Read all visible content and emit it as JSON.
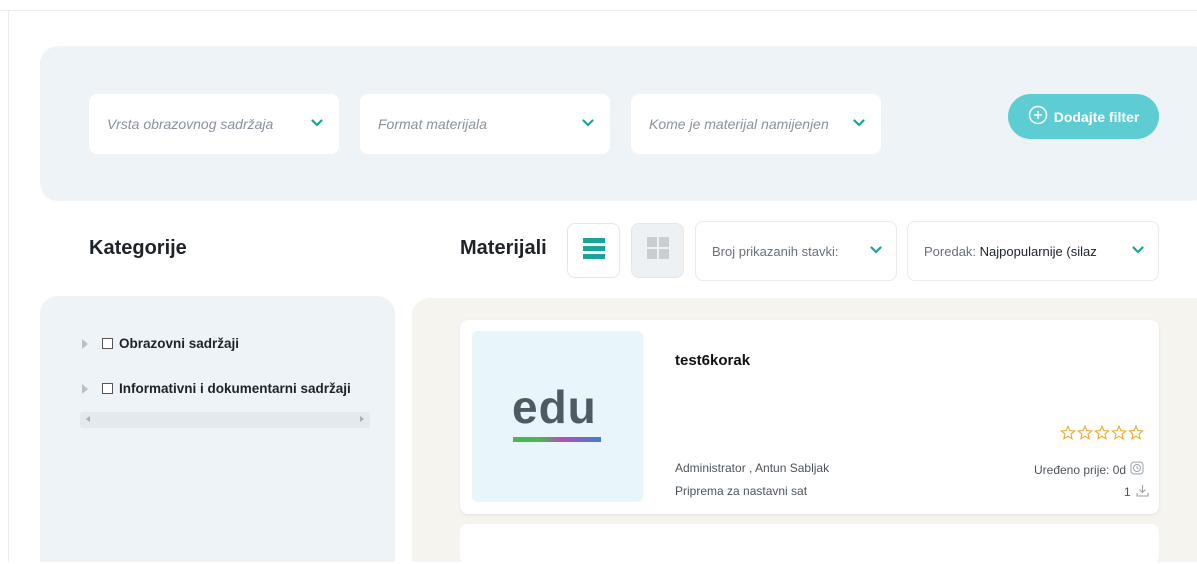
{
  "filters": {
    "type_placeholder": "Vrsta obrazovnog sadržaja",
    "format_placeholder": "Format materijala",
    "audience_placeholder": "Kome je materijal namijenjen",
    "add_filter_label": "Dodajte filter"
  },
  "categories": {
    "heading": "Kategorije",
    "items": [
      {
        "label": "Obrazovni sadržaji"
      },
      {
        "label": "Informativni i dokumentarni sadržaji"
      }
    ]
  },
  "materials": {
    "heading": "Materijali",
    "items_per_page_label": "Broj prikazanih stavki:",
    "sort_label": "Poredak:",
    "sort_value": "Najpopularnije (silaz",
    "cards": [
      {
        "thumbnail_text": "edu",
        "title": "test6korak",
        "authors": "Administrator , Antun Sabljak",
        "type": "Priprema za nastavni sat",
        "edited": "Uređeno prije: 0d",
        "downloads": "1",
        "rating": 0
      }
    ]
  },
  "colors": {
    "accent": "#5ecdd3",
    "list_icon": "#1aa39a",
    "stars": "#f0a72b",
    "panel_bg": "#eef3f7"
  }
}
